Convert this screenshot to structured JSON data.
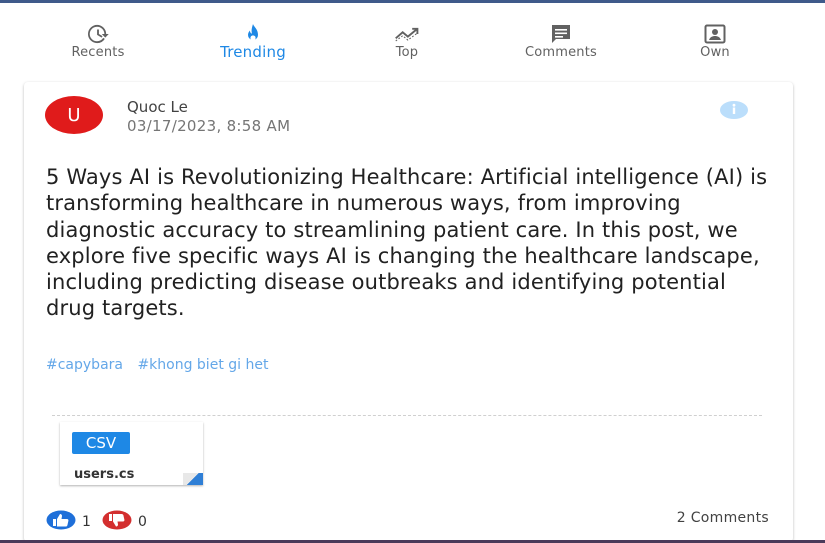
{
  "tabs": [
    {
      "label": "Recents",
      "icon": "history-icon"
    },
    {
      "label": "Trending",
      "icon": "flame-icon"
    },
    {
      "label": "Top",
      "icon": "trending-up-icon"
    },
    {
      "label": "Comments",
      "icon": "comment-icon"
    },
    {
      "label": "Own",
      "icon": "account-box-icon"
    }
  ],
  "active_tab": "Trending",
  "post": {
    "avatar_letter": "U",
    "author": "Quoc Le",
    "datetime": "03/17/2023, 8:58 AM",
    "body": "5 Ways AI is Revolutionizing Healthcare: Artificial intelligence (AI) is transforming healthcare in numerous ways, from improving diagnostic accuracy to streamlining patient care. In this post, we explore five specific ways AI is changing the healthcare landscape, including predicting disease outbreaks and identifying potential drug targets.",
    "tags": [
      "#capybara",
      "#khong biet gi het"
    ],
    "attachment": {
      "type": "CSV",
      "name": "users.cs"
    },
    "likes": "1",
    "dislikes": "0",
    "comments": "2 Comments"
  },
  "colors": {
    "accent": "#1e88e5",
    "avatar": "#e01b1b",
    "dislike": "#d32f2f",
    "tag": "#64a7e8"
  }
}
